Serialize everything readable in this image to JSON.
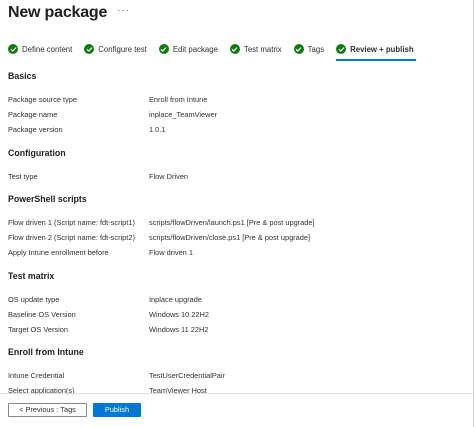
{
  "header": {
    "title": "New package",
    "more_label": "···"
  },
  "wizard": {
    "steps": [
      {
        "label": "Define content",
        "state": "complete"
      },
      {
        "label": "Configure test",
        "state": "complete"
      },
      {
        "label": "Edit package",
        "state": "complete"
      },
      {
        "label": "Test matrix",
        "state": "complete"
      },
      {
        "label": "Tags",
        "state": "complete"
      },
      {
        "label": "Review + publish",
        "state": "current"
      }
    ]
  },
  "sections": {
    "basics": {
      "title": "Basics",
      "rows": [
        {
          "label": "Package source type",
          "value": "Enroll from Intune"
        },
        {
          "label": "Package name",
          "value": "inplace_TeamViewer"
        },
        {
          "label": "Package version",
          "value": "1.0.1"
        }
      ]
    },
    "configuration": {
      "title": "Configuration",
      "rows": [
        {
          "label": "Test type",
          "value": "Flow Driven"
        }
      ]
    },
    "powershell": {
      "title": "PowerShell scripts",
      "rows": [
        {
          "label": "Flow driven 1 (Script name: fdt-script1)",
          "value": "scripts/flowDriven/launch.ps1 [Pre & post upgrade]"
        },
        {
          "label": "Flow driven 2 (Script name: fdt-script2)",
          "value": "scripts/flowDriven/close.ps1 [Pre & post upgrade]"
        },
        {
          "label": "Apply Intune enrollment before",
          "value": "Flow driven 1"
        }
      ]
    },
    "test_matrix": {
      "title": "Test matrix",
      "rows": [
        {
          "label": "OS update type",
          "value": "Inplace upgrade"
        },
        {
          "label": "Baseline OS Version",
          "value": "Windows 10 22H2"
        },
        {
          "label": "Target OS Version",
          "value": "Windows 11 22H2"
        }
      ]
    },
    "enroll": {
      "title": "Enroll from Intune",
      "rows": [
        {
          "label": "Intune Credential",
          "value": "TestUserCredentialPair"
        },
        {
          "label": "Select application(s)",
          "value": "TeamViewer Host"
        }
      ]
    }
  },
  "footer": {
    "previous_label": "< Previous : Tags",
    "publish_label": "Publish"
  },
  "colors": {
    "accent": "#0078d4",
    "success": "#107c10",
    "text": "#323130"
  }
}
